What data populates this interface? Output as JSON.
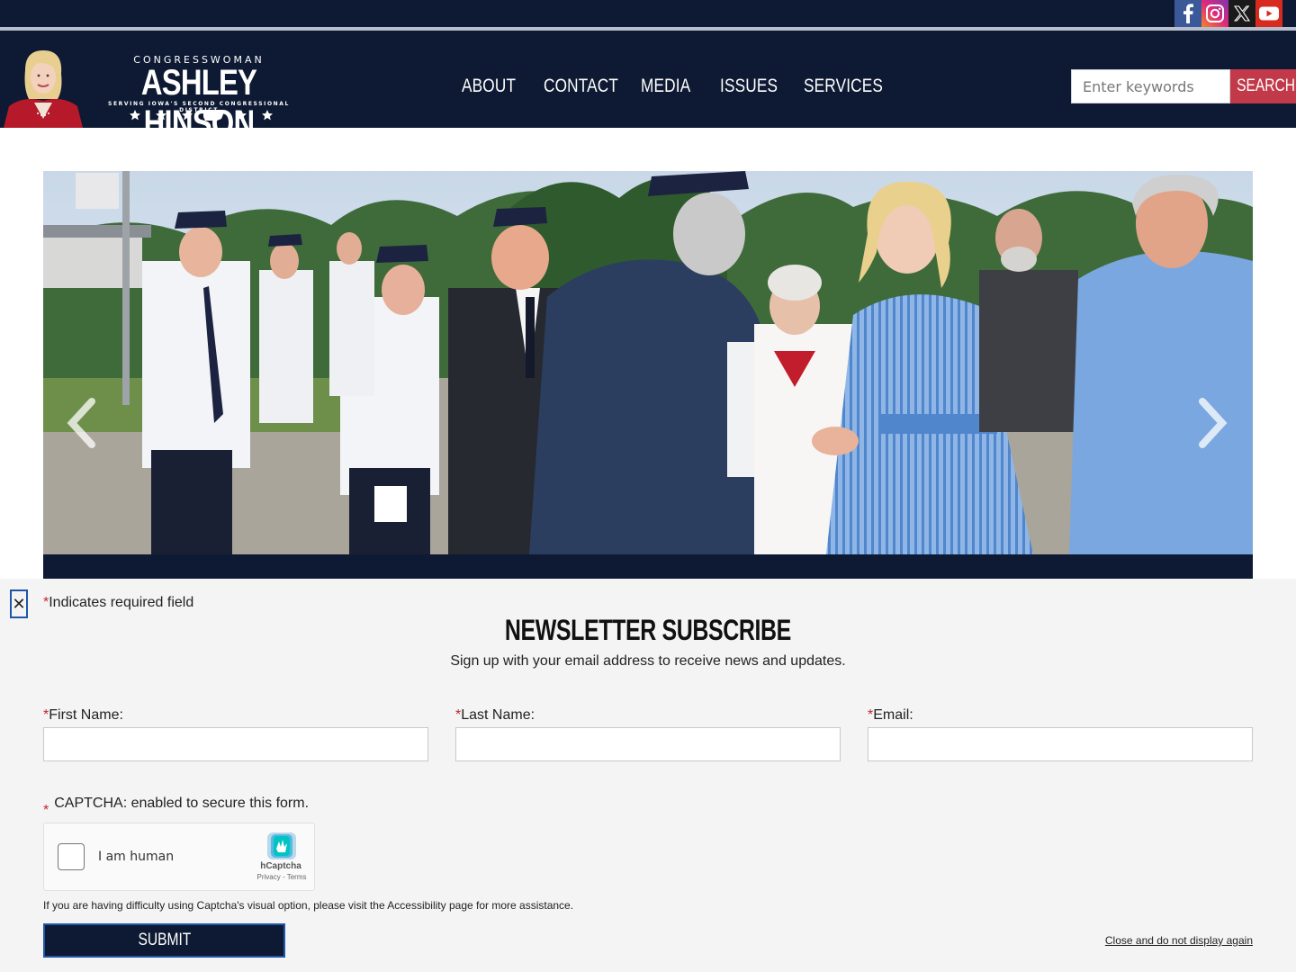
{
  "social": {
    "facebook": "facebook-icon",
    "instagram": "instagram-icon",
    "x": "x-icon",
    "youtube": "youtube-icon"
  },
  "logo": {
    "title_small": "CONGRESSWOMAN",
    "name": "ASHLEY HINSON",
    "tagline": "SERVING IOWA'S SECOND CONGRESSIONAL DISTRICT"
  },
  "nav": {
    "items": [
      "ABOUT",
      "CONTACT",
      "MEDIA",
      "ISSUES",
      "SERVICES"
    ]
  },
  "search": {
    "placeholder": "Enter keywords",
    "button": "SEARCH"
  },
  "newsletter": {
    "required_note": "Indicates required field",
    "title": "NEWSLETTER SUBSCRIBE",
    "description": "Sign up with your email address to receive news and updates.",
    "fields": {
      "first_name": "First Name:",
      "last_name": "Last Name:",
      "email": "Email:"
    },
    "captcha_label": "CAPTCHA: enabled to secure this form.",
    "captcha": {
      "checkbox_text": "I am human",
      "brand": "hCaptcha",
      "links": "Privacy - Terms"
    },
    "help_text": "If you are having difficulty using Captcha's visual option, please visit the Accessibility page for more assistance.",
    "submit": "SUBMIT",
    "close_link": "Close and do not display again"
  },
  "colors": {
    "navy": "#0e1a33",
    "accent_red": "#c23a4a",
    "outline_blue": "#1f56a8"
  }
}
